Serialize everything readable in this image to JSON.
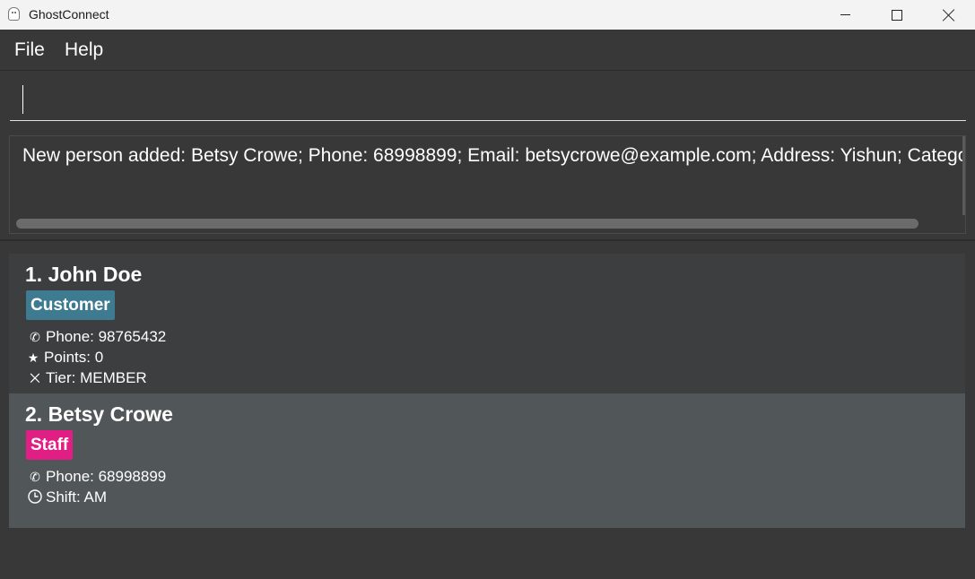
{
  "window": {
    "title": "GhostConnect"
  },
  "menu": {
    "file": "File",
    "help": "Help"
  },
  "command": {
    "value": "",
    "placeholder": ""
  },
  "result": {
    "text": "New person added: Betsy Crowe; Phone: 68998899; Email: betsycrowe@example.com; Address: Yishun; Category: [S"
  },
  "colors": {
    "customer_tag": "#3e7b91",
    "staff_tag": "#e01e84",
    "background": "#383838",
    "selected_card": "#515658"
  },
  "persons": [
    {
      "name": "1. John Doe",
      "tag": "Customer",
      "phone": "Phone: 98765432",
      "points": "Points: 0",
      "tier": "Tier: MEMBER"
    },
    {
      "name": "2. Betsy Crowe",
      "tag": "Staff",
      "phone": "Phone: 68998899",
      "shift": "Shift: AM"
    }
  ],
  "icons": {
    "phone": "phone-icon",
    "points": "star-icon",
    "tier": "medal-icon",
    "shift": "clock-icon"
  }
}
